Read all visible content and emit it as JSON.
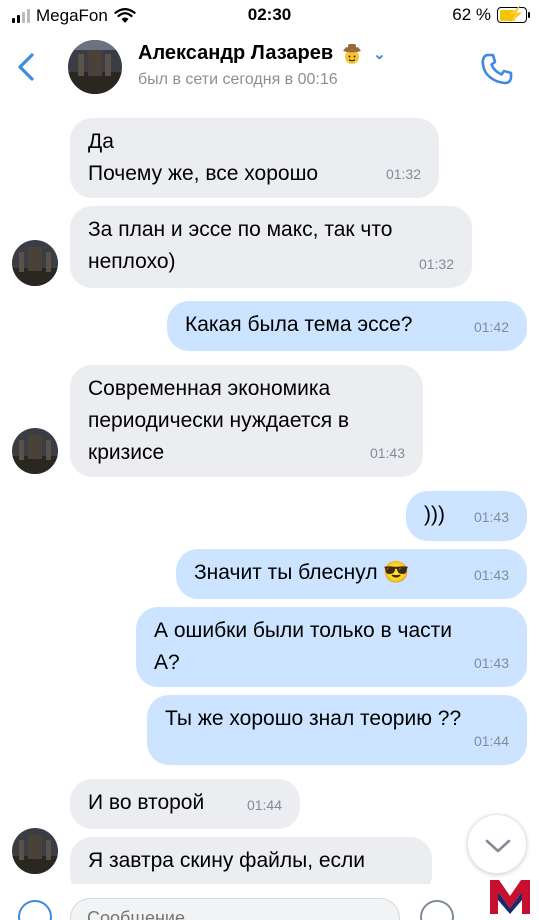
{
  "status": {
    "carrier": "MegaFon",
    "time": "02:30",
    "battery": "62 %"
  },
  "header": {
    "name": "Александр Лазарев",
    "last_seen": "был в сети сегодня в 00:16"
  },
  "messages": [
    {
      "dir": "in",
      "text": "Да\nПочему же, все хорошо",
      "time": "01:32"
    },
    {
      "dir": "in",
      "text": "За план и эссе по макс, так что\nнеплохо)",
      "time": "01:32"
    },
    {
      "dir": "out",
      "text": "Какая была тема эссе?",
      "time": "01:42"
    },
    {
      "dir": "in",
      "text": "Современная экономика\nпериодически нуждается в\nкризисе",
      "time": "01:43"
    },
    {
      "dir": "out",
      "text": ")))",
      "time": "01:43"
    },
    {
      "dir": "out",
      "text": "Значит ты блеснул 😎",
      "time": "01:43"
    },
    {
      "dir": "out",
      "text": "А ошибки были только в части\nА?",
      "time": "01:43"
    },
    {
      "dir": "out",
      "text": "Ты же хорошо знал теорию ??",
      "time": "01:44"
    },
    {
      "dir": "in",
      "text": "И во второй",
      "time": "01:44"
    },
    {
      "dir": "in",
      "text": "Я завтра скину файлы, если",
      "time": ""
    }
  ],
  "input": {
    "placeholder": "Сообщение"
  }
}
